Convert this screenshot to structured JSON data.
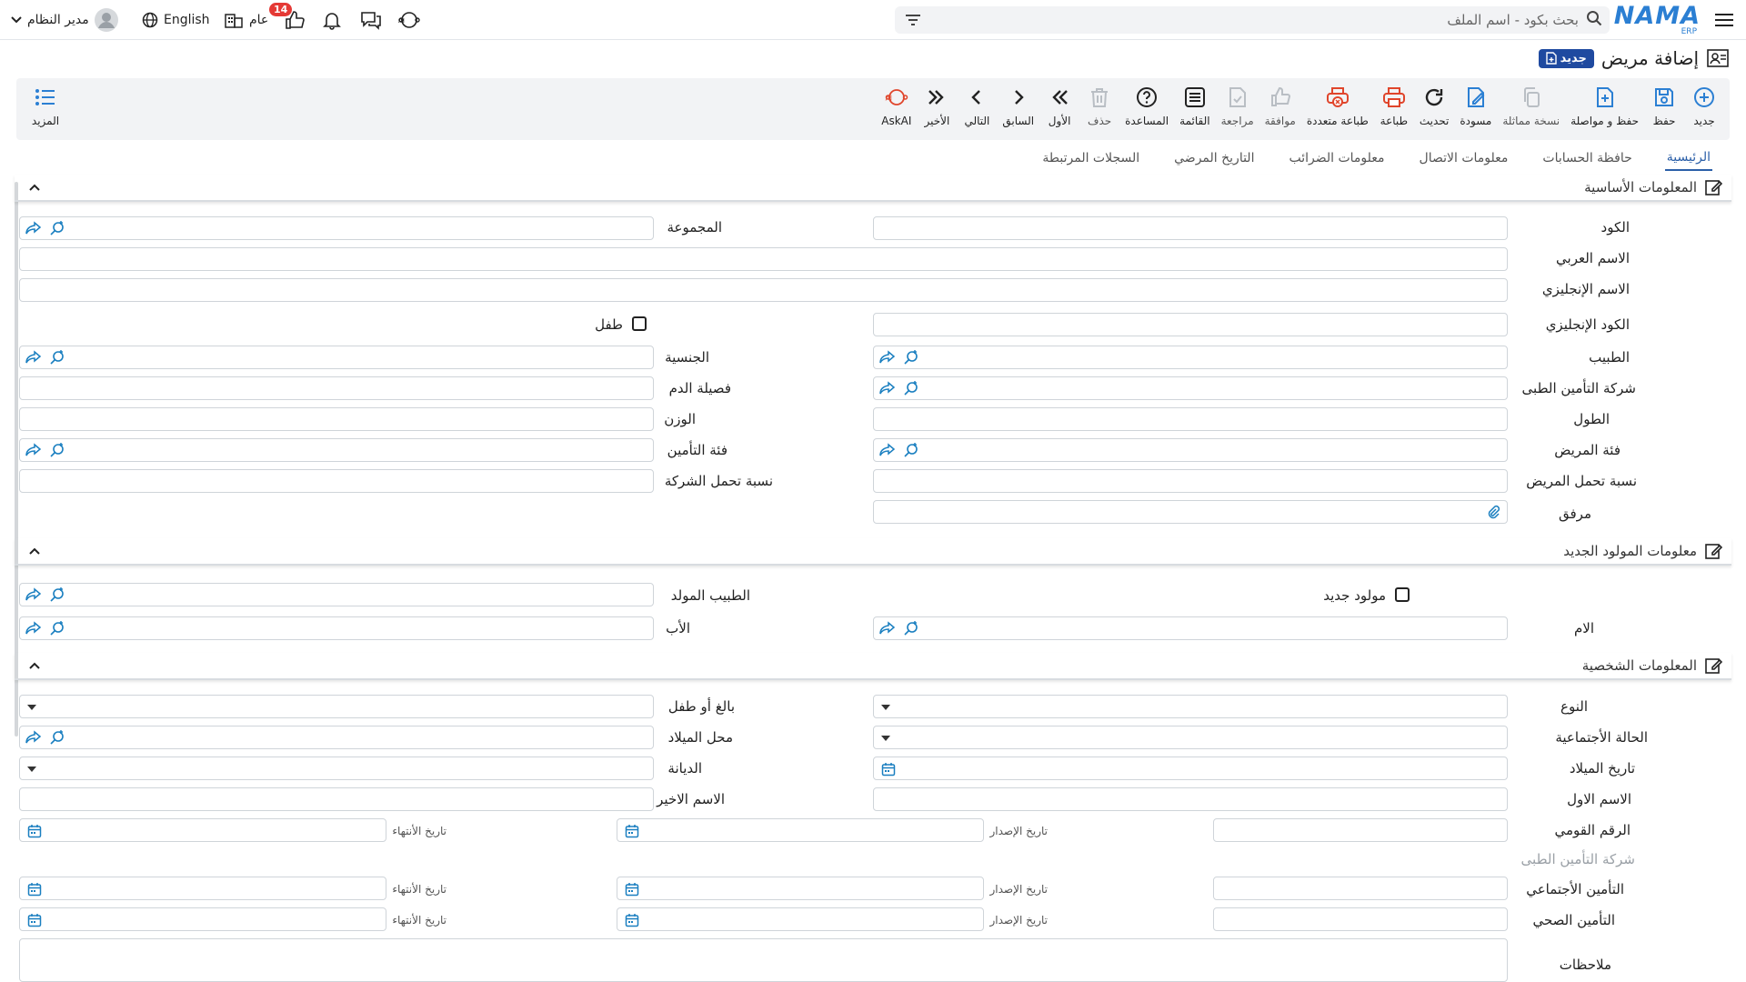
{
  "topbar": {
    "logo_text": "NAMA",
    "logo_sub": "ERP",
    "search_placeholder": "بحث بكود - اسم الملف",
    "notification_count": "14",
    "branch_label": "عام",
    "language_label": "English",
    "user_name": "مدير النظام"
  },
  "page": {
    "title": "إضافة مريض",
    "new_badge": "جديد"
  },
  "toolbar": {
    "tools": [
      {
        "id": "new",
        "label": "جديد",
        "icon": "plus-circle-icon",
        "enabled": true
      },
      {
        "id": "save",
        "label": "حفظ",
        "icon": "save-icon",
        "enabled": true
      },
      {
        "id": "save-continue",
        "label": "حفظ و مواصلة",
        "icon": "save-continue-icon",
        "enabled": true
      },
      {
        "id": "duplicate",
        "label": "نسخة مماثلة",
        "icon": "copy-icon",
        "enabled": false
      },
      {
        "id": "draft",
        "label": "مسودة",
        "icon": "draft-icon",
        "enabled": true
      },
      {
        "id": "refresh",
        "label": "تحديث",
        "icon": "refresh-icon",
        "enabled": true
      },
      {
        "id": "print",
        "label": "طباعة",
        "icon": "printer-icon",
        "enabled": true
      },
      {
        "id": "multi-print",
        "label": "طباعة متعددة",
        "icon": "multi-print-icon",
        "enabled": true
      },
      {
        "id": "approve",
        "label": "موافقة",
        "icon": "thumbs-up-icon",
        "enabled": false
      },
      {
        "id": "review",
        "label": "مراجعة",
        "icon": "review-icon",
        "enabled": false
      },
      {
        "id": "list",
        "label": "القائمة",
        "icon": "list-icon",
        "enabled": true
      },
      {
        "id": "help",
        "label": "المساعدة",
        "icon": "help-icon",
        "enabled": true
      },
      {
        "id": "delete",
        "label": "حذف",
        "icon": "trash-icon",
        "enabled": false
      },
      {
        "id": "first",
        "label": "الأول",
        "icon": "first-icon",
        "enabled": true
      },
      {
        "id": "prev",
        "label": "السابق",
        "icon": "prev-icon",
        "enabled": true
      },
      {
        "id": "next",
        "label": "التالي",
        "icon": "next-icon",
        "enabled": true
      },
      {
        "id": "last",
        "label": "الأخير",
        "icon": "last-icon",
        "enabled": true
      },
      {
        "id": "askai",
        "label": "AskAI",
        "icon": "ai-icon",
        "enabled": true
      }
    ],
    "more_label": "المزيد"
  },
  "tabs": [
    {
      "label": "الرئيسية",
      "active": true
    },
    {
      "label": "حافظة الحسابات",
      "active": false
    },
    {
      "label": "معلومات الاتصال",
      "active": false
    },
    {
      "label": "معلومات الضرائب",
      "active": false
    },
    {
      "label": "التاريخ المرضي",
      "active": false
    },
    {
      "label": "السجلات المرتبطة",
      "active": false
    }
  ],
  "sections": {
    "basic": "المعلومات الأساسية",
    "newborn": "معلومات المولود الجديد",
    "personal": "المعلومات الشخصية"
  },
  "basic": {
    "code": "الكود",
    "group": "المجموعة",
    "arabic_name": "الاسم العربي",
    "english_name": "الاسم الإنجليزي",
    "english_code": "الكود الإنجليزي",
    "child": "طفل",
    "doctor": "الطبيب",
    "nationality": "الجنسية",
    "insurance_company": "شركة التأمين الطبى",
    "blood_type": "فصيلة الدم",
    "height": "الطول",
    "weight": "الوزن",
    "patient_category": "فئة المريض",
    "insurance_category": "فئة التأمين",
    "patient_share": "نسبة تحمل المريض",
    "company_share": "نسبة تحمل الشركة",
    "attachment": "مرفق"
  },
  "newborn": {
    "is_newborn": "مولود جديد",
    "delivery_doctor": "الطبيب المولد",
    "mother": "الام",
    "father": "الأب"
  },
  "personal": {
    "gender": "النوع",
    "adult_or_child": "بالغ أو طفل",
    "marital_status": "الحالة الأجتماعية",
    "birth_place": "محل الميلاد",
    "birth_date": "تاريخ الميلاد",
    "religion": "الديانة",
    "first_name": "الاسم الاول",
    "last_name": "الاسم الاخير",
    "national_id": "الرقم القومي",
    "issue_date": "تاريخ الإصدار",
    "expiry_date": "تاريخ الأنتهاء",
    "insurance_company": "شركة التأمين الطبى",
    "social_insurance": "التأمين الأجتماعي",
    "health_insurance": "التأمين الصحي",
    "notes": "ملاحظات"
  },
  "colors": {
    "accent": "#2b7fd3",
    "badge": "#e53935",
    "new_badge": "#1f4aa0",
    "print": "#e0452b",
    "field_icon": "#1a7fc0"
  }
}
